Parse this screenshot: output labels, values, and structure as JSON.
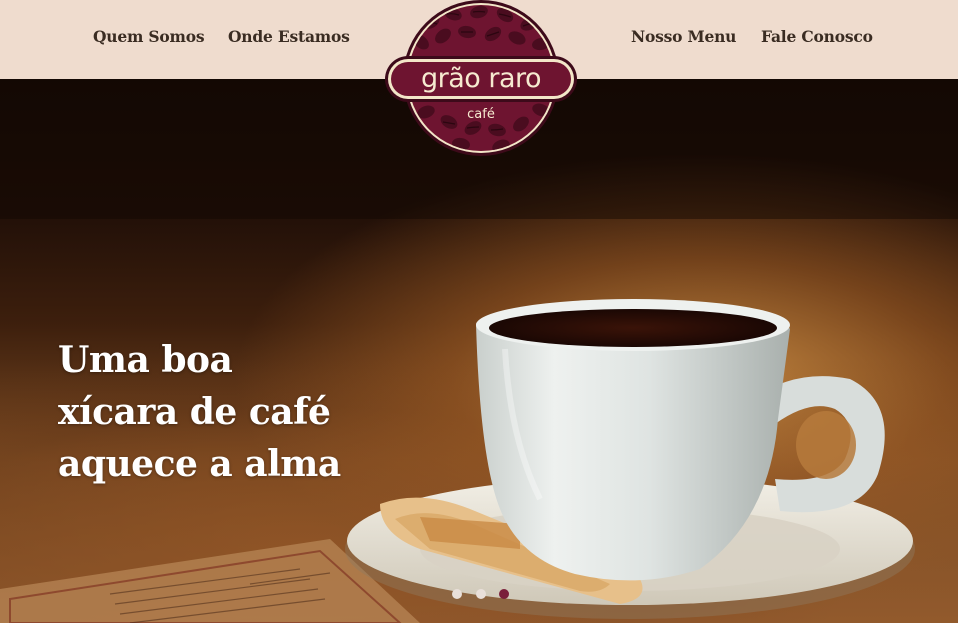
{
  "nav": {
    "left": [
      {
        "label": "Quem Somos"
      },
      {
        "label": "Onde Estamos"
      }
    ],
    "right": [
      {
        "label": "Nosso Menu"
      },
      {
        "label": "Fale Conosco"
      }
    ]
  },
  "logo": {
    "name": "grão raro",
    "subtitle": "café"
  },
  "hero": {
    "headline_lines": [
      "Uma boa",
      "xícara de café",
      "aquece a alma"
    ],
    "slider": {
      "slide_count": 3,
      "active_slide": 3
    }
  },
  "colors": {
    "header_bg": "#efdcce",
    "nav_text": "#3a2c22",
    "brand_wine": "#6e1430",
    "brand_cream": "#f3e6c8",
    "dot_inactive": "#e9e0da",
    "dot_active": "#7a1e3a"
  }
}
